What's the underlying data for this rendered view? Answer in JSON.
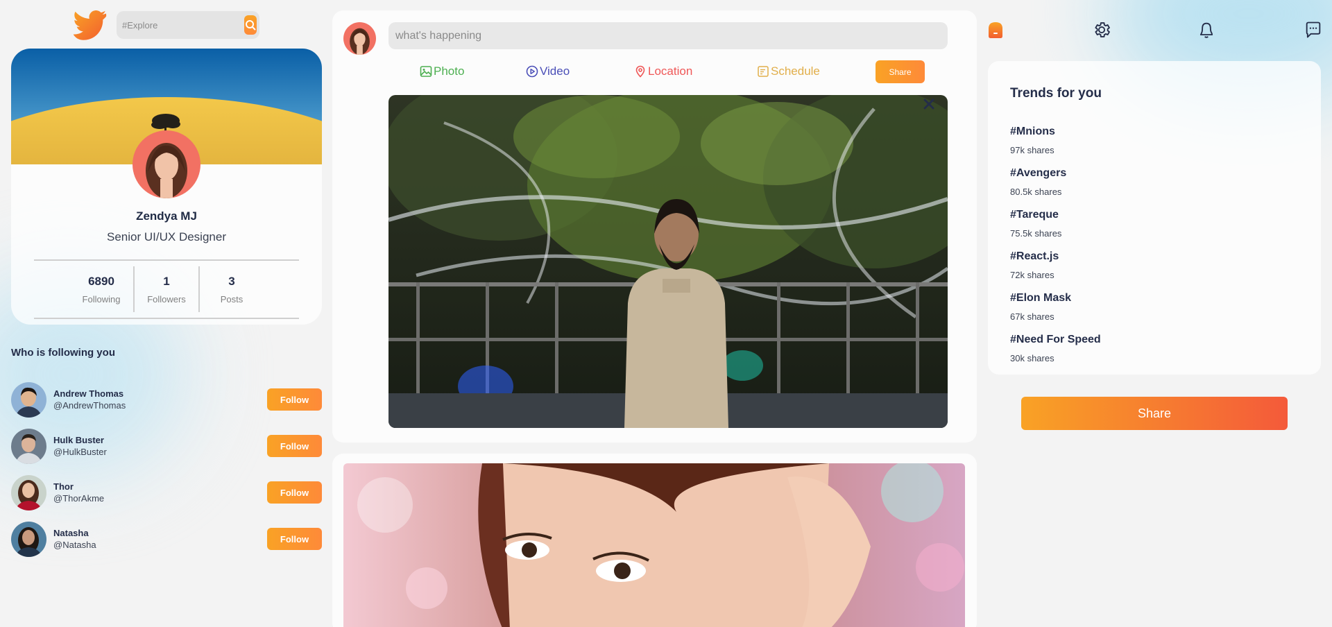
{
  "search": {
    "placeholder": "#Explore"
  },
  "profile": {
    "name": "Zendya MJ",
    "role": "Senior UI/UX Designer",
    "stats": [
      {
        "value": "6890",
        "label": "Following"
      },
      {
        "value": "1",
        "label": "Followers"
      },
      {
        "value": "3",
        "label": "Posts"
      }
    ]
  },
  "followers": {
    "title": "Who is following you",
    "follow_label": "Follow",
    "items": [
      {
        "name": "Andrew Thomas",
        "handle": "@AndrewThomas"
      },
      {
        "name": "Hulk Buster",
        "handle": "@HulkBuster"
      },
      {
        "name": "Thor",
        "handle": "@ThorAkme"
      },
      {
        "name": "Natasha",
        "handle": "@Natasha"
      }
    ]
  },
  "post_share": {
    "placeholder": "what's happening",
    "options": {
      "photo": "Photo",
      "video": "Video",
      "location": "Location",
      "schedule": "Schedule"
    },
    "share_label": "Share"
  },
  "trends": {
    "title": "Trends for you",
    "items": [
      {
        "tag": "#Mnions",
        "shares": "97k shares"
      },
      {
        "tag": "#Avengers",
        "shares": "80.5k shares"
      },
      {
        "tag": "#Tareque",
        "shares": "75.5k shares"
      },
      {
        "tag": "#React.js",
        "shares": "72k shares"
      },
      {
        "tag": "#Elon Mask",
        "shares": "67k shares"
      },
      {
        "tag": "#Need For Speed",
        "shares": "30k shares"
      }
    ]
  },
  "right_share_label": "Share",
  "colors": {
    "accent_start": "#f9a225",
    "accent_end": "#fe8a39",
    "photo": "#4caf50",
    "video": "#4a4eb7",
    "location": "#ef5757",
    "schedule": "#e1ae4a"
  }
}
